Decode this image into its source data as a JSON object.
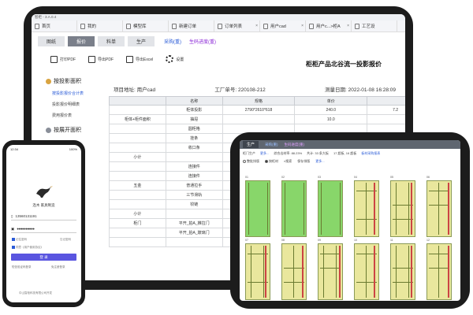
{
  "monitor": {
    "app_title": "智柜 - 3.A.0.4",
    "tabs": [
      {
        "label": "首页"
      },
      {
        "label": "我的"
      },
      {
        "label": "模型库"
      },
      {
        "label": "新建订单"
      },
      {
        "label": "订单列表"
      },
      {
        "label": "用户cad"
      },
      {
        "label": "用户c...>柜A"
      },
      {
        "label": "工艺设"
      }
    ],
    "menu": {
      "buttons": [
        {
          "label": "图纸"
        },
        {
          "label": "报价"
        },
        {
          "label": "料单"
        },
        {
          "label": "生产"
        }
      ],
      "link_purchase": "采购(重)",
      "link_progress": "生码进度(重)"
    },
    "toolbar": [
      {
        "label": "打印PDF"
      },
      {
        "label": "导出PDF"
      },
      {
        "label": "导出Excel"
      },
      {
        "label": "设置"
      }
    ],
    "sidebar": {
      "section1": "按投影面积",
      "items": [
        {
          "label": "按投影报价合计表"
        },
        {
          "label": "投影报价明细表"
        },
        {
          "label": "费用报价表"
        }
      ],
      "section2": "按展开面积"
    },
    "report": {
      "title": "柜柜产品北谷流一投影报价",
      "project_label": "项目地址: 用户cad",
      "order_label": "工厂单号: 220108-212",
      "date_label": "测量日期: 2022-01-08 16:28:09",
      "columns": [
        "",
        "名称",
        "规格",
        "单价",
        ""
      ],
      "rows": [
        [
          "",
          "柜体投影",
          "2790*2610*618",
          "240.0",
          "7.2"
        ],
        [
          "柜体+柜件面积",
          "抽屉",
          "",
          "10.0",
          ""
        ],
        [
          "",
          "圆柜格",
          "",
          "",
          ""
        ],
        [
          "",
          "挂条",
          "",
          "",
          ""
        ],
        [
          "",
          "收口条",
          "",
          "",
          ""
        ],
        [
          "小计",
          "",
          "",
          "",
          ""
        ],
        [
          "",
          "连接件",
          "",
          "",
          ""
        ],
        [
          "",
          "连接件",
          "",
          "",
          ""
        ],
        [
          "五金",
          "普通拉手",
          "",
          "",
          ""
        ],
        [
          "",
          "三节滑轨",
          "",
          "",
          ""
        ],
        [
          "",
          "铰链",
          "",
          "",
          ""
        ],
        [
          "小计",
          "",
          "",
          "",
          ""
        ],
        [
          "柜门",
          "平开_拍A_推拉门",
          "",
          "",
          ""
        ],
        [
          "",
          "平开_拍A_玻璃门",
          "",
          "",
          ""
        ],
        [
          "",
          "",
          "",
          "",
          ""
        ]
      ]
    }
  },
  "tablet": {
    "tab_label": "生产",
    "link1": "采购(重)",
    "link2": "生码进度(重)",
    "info": [
      "柜门生产",
      "更多...",
      "综合出材率: 88.23%",
      "共计: 33 条大板",
      "17 超板, 16 超板",
      "板材采购报表"
    ],
    "options": [
      "整批排版",
      "按柜材",
      "搜索",
      "保存排版",
      "更多..."
    ],
    "thumb_labels": [
      "01",
      "02",
      "03",
      "04",
      "05",
      "06",
      "07",
      "08",
      "09",
      "10",
      "11",
      "12"
    ]
  },
  "phone": {
    "time": "12:34",
    "battery": "100%",
    "brand": "连木 家具制造",
    "phone_number": "13560131191",
    "password": "●●●●●●●●●●",
    "remember": "记住密码",
    "forgot": "忘记密码",
    "agree": "同意《用户使用协议》",
    "login": "登 录",
    "alt1": "短信验证码登录",
    "alt2": "免注册登录",
    "footer": "中山智柜科技有限公司开发"
  },
  "colors": {
    "frame": "#1c1c1c",
    "active_tab": "#7a7f8a",
    "link_blue": "#2a5bd7",
    "login_button": "#5a55e0",
    "panel_green": "#88d66a",
    "panel_yellow": "#e9e79d"
  }
}
